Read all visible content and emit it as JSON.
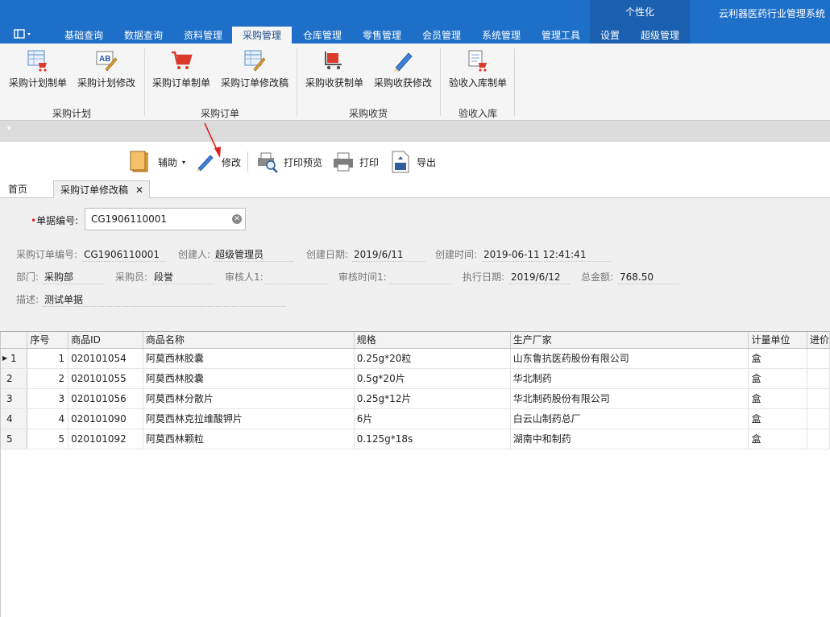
{
  "app_title": "云利器医药行业管理系统",
  "personalize_label": "个性化",
  "menu_tabs": [
    "基础查询",
    "数据查询",
    "资料管理",
    "采购管理",
    "仓库管理",
    "零售管理",
    "会员管理",
    "系统管理",
    "管理工具",
    "设置",
    "超级管理"
  ],
  "active_tab": "采购管理",
  "ribbon": {
    "buttons": [
      "采购计划制单",
      "采购计划修改",
      "采购订单制单",
      "采购订单修改稿",
      "采购收获制单",
      "采购收获修改",
      "验收入库制单"
    ],
    "groups": [
      "采购计划",
      "采购订单",
      "采购收货",
      "验收入库"
    ]
  },
  "toolbar": {
    "assist": "辅助",
    "edit": "修改",
    "print_preview": "打印预览",
    "print": "打印",
    "export": "导出"
  },
  "doc_tabs": {
    "home": "首页",
    "active": "采购订单修改稿"
  },
  "form": {
    "doc_no_label": "单据编号:",
    "doc_no_value": "CG1906110001",
    "order_no_label": "采购订单编号:",
    "order_no_value": "CG1906110001",
    "creator_label": "创建人:",
    "creator_value": "超级管理员",
    "create_date_label": "创建日期:",
    "create_date_value": "2019/6/11",
    "create_time_label": "创建时间:",
    "create_time_value": "2019-06-11 12:41:41",
    "dept_label": "部门:",
    "dept_value": "采购部",
    "buyer_label": "采购员:",
    "buyer_value": "段誉",
    "auditor_label": "审核人1:",
    "auditor_value": "",
    "audit_time_label": "审核时间1:",
    "audit_time_value": "",
    "exec_date_label": "执行日期:",
    "exec_date_value": "2019/6/12",
    "total_label": "总金额:",
    "total_value": "768.50",
    "desc_label": "描述:",
    "desc_value": "测试单据"
  },
  "grid": {
    "columns": [
      "序号",
      "商品ID",
      "商品名称",
      "规格",
      "生产厂家",
      "计量单位",
      "进价"
    ],
    "rows": [
      {
        "row": "1",
        "seq": "1",
        "id": "020101054",
        "name": "阿莫西林胶囊",
        "spec": "0.25g*20粒",
        "maker": "山东鲁抗医药股份有限公司",
        "unit": "盒"
      },
      {
        "row": "2",
        "seq": "2",
        "id": "020101055",
        "name": "阿莫西林胶囊",
        "spec": "0.5g*20片",
        "maker": "华北制药",
        "unit": "盒"
      },
      {
        "row": "3",
        "seq": "3",
        "id": "020101056",
        "name": "阿莫西林分散片",
        "spec": "0.25g*12片",
        "maker": "华北制药股份有限公司",
        "unit": "盒"
      },
      {
        "row": "4",
        "seq": "4",
        "id": "020101090",
        "name": "阿莫西林克拉维酸钾片",
        "spec": "6片",
        "maker": "白云山制药总厂",
        "unit": "盒"
      },
      {
        "row": "5",
        "seq": "5",
        "id": "020101092",
        "name": "阿莫西林颗粒",
        "spec": "0.125g*18s",
        "maker": "湖南中和制药",
        "unit": "盒"
      }
    ]
  }
}
